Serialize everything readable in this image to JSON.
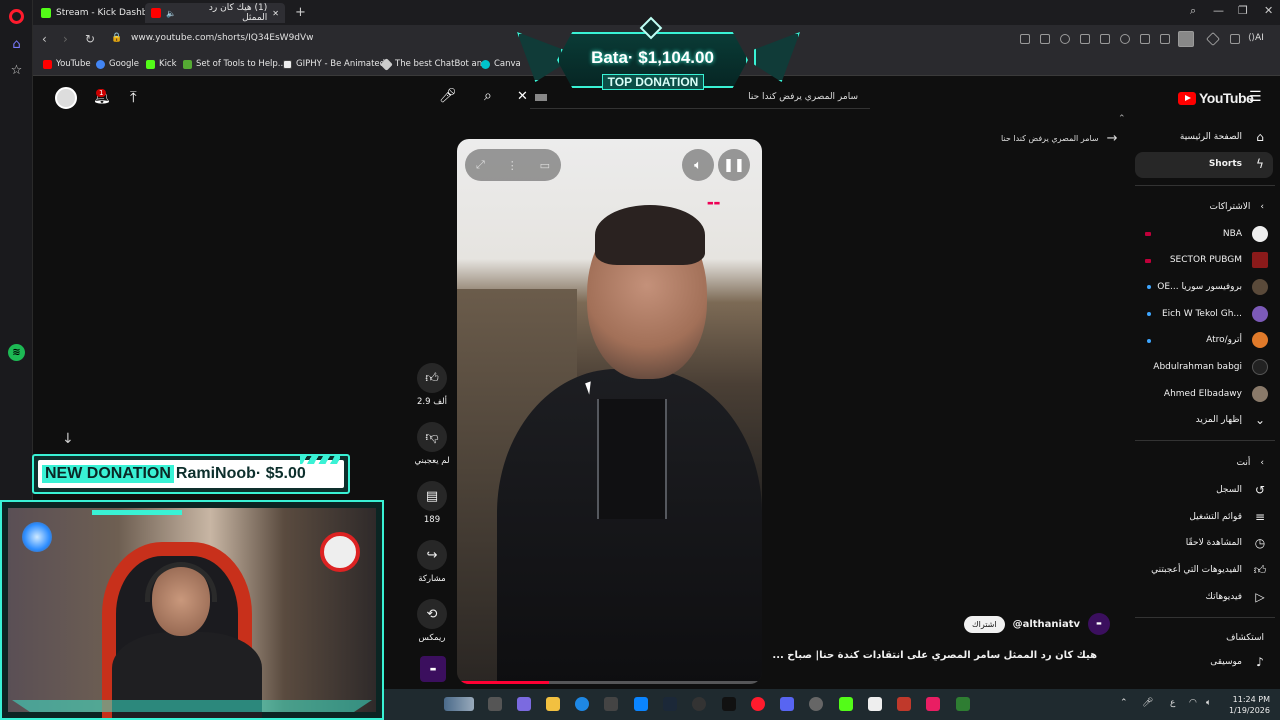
{
  "browser": {
    "tabs": [
      {
        "label": "Stream - Kick Dashboard"
      },
      {
        "label": "(1) هيك كان رد الممثل"
      }
    ],
    "url": "www.youtube.com/shorts/IQ34EsW9dVw",
    "bookmarks": [
      {
        "label": "YouTube"
      },
      {
        "label": "Google"
      },
      {
        "label": "Kick"
      },
      {
        "label": "Set of Tools to Help..."
      },
      {
        "label": "GIPHY - Be Animated"
      },
      {
        "label": "The best ChatBot an..."
      },
      {
        "label": "Canva"
      }
    ],
    "ai_label": "AI"
  },
  "overlay": {
    "top_donation_amount": "Bata· $1,104.00",
    "top_donation_label": "TOP DONATION",
    "new_donation_label": "NEW DONATION",
    "new_donation_text": "RamiNoob· $5.00"
  },
  "youtube": {
    "logo": "YouTube",
    "search_query": "سامر المصري يرفض كندا حنا",
    "back_query": "سامر المصري يرفض كندا حنا",
    "notifications_badge": "1",
    "sidebar": {
      "home": "الصفحة الرئيسية",
      "shorts": "Shorts",
      "subscriptions_header": "الاشتراكات",
      "subscriptions": [
        {
          "label": "NBA"
        },
        {
          "label": "SECTOR PUBGM"
        },
        {
          "label": "OE... بروفيسور سوريا"
        },
        {
          "label": "Eich W Tekol Gh..."
        },
        {
          "label": "Atro/أترو"
        },
        {
          "label": "Abdulrahman babgi"
        },
        {
          "label": "Ahmed Elbadawy"
        }
      ],
      "show_more": "إظهار المزيد",
      "you_header": "أنت",
      "you_items": [
        {
          "label": "السجل"
        },
        {
          "label": "قوائم التشغيل"
        },
        {
          "label": "المشاهدة لاحقًا"
        },
        {
          "label": "الفيديوهات التي أعجبتني"
        },
        {
          "label": "فيديوهاتك"
        }
      ],
      "explore_header": "استكشاف",
      "explore_items": [
        {
          "label": "موسيقى"
        }
      ]
    },
    "actions": {
      "likes": "2.9 ألف",
      "dislike": "لم يعجبني",
      "comments": "189",
      "share": "مشاركة",
      "remix": "ريمكس"
    },
    "video": {
      "channel": "@althaniatv",
      "subscribe": "اشتراك",
      "title": "هيك كان رد الممثل سامر المصري على انتقادات كندة حنا| صباح ...",
      "progress": 0.3
    }
  },
  "taskbar": {
    "time": "11:24 PM",
    "date": "1/19/2026",
    "lang": "ع"
  }
}
